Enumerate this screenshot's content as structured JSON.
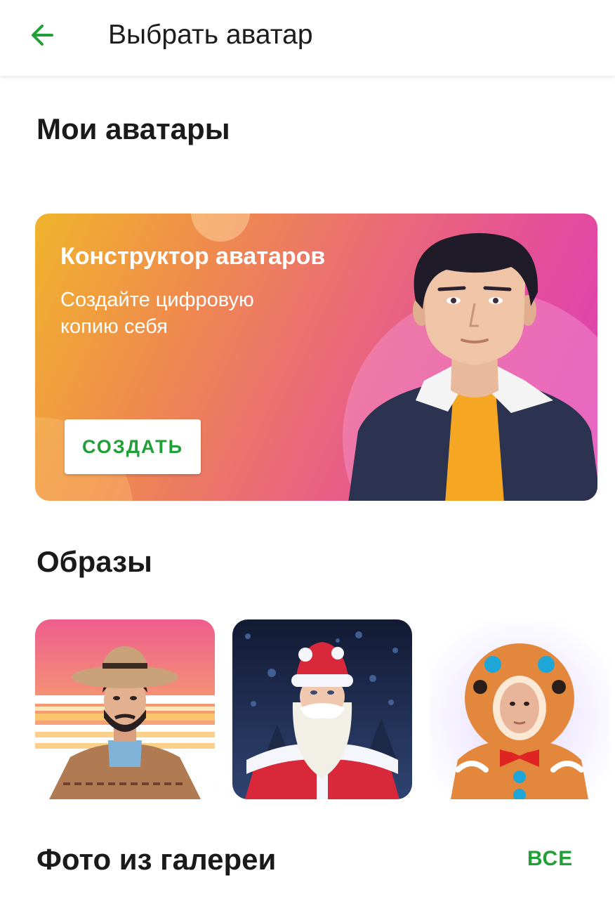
{
  "header": {
    "title": "Выбрать аватар",
    "back_icon": "arrow-left-icon",
    "accent": "#21a038"
  },
  "my_avatars": {
    "title": "Мои аватары"
  },
  "promo": {
    "title": "Конструктор аватаров",
    "subtitle": "Создайте цифровую копию себя",
    "button_label": "СОЗДАТЬ",
    "gradient": [
      "#f0b42c",
      "#ea6a78",
      "#dd3db8"
    ]
  },
  "looks": {
    "title": "Образы",
    "items": [
      {
        "name": "cowboy"
      },
      {
        "name": "ded-moroz"
      },
      {
        "name": "gingerbread"
      }
    ]
  },
  "gallery": {
    "title": "Фото из галереи",
    "all_label": "ВСЕ"
  }
}
